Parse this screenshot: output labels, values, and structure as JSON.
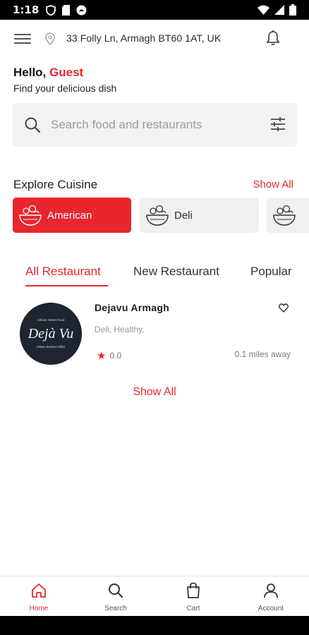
{
  "status_bar": {
    "time": "1:18"
  },
  "header": {
    "address": "33 Folly Ln, Armagh BT60 1AT, UK"
  },
  "greeting": {
    "hello": "Hello,",
    "name": "Guest",
    "subtitle": "Find your delicious dish"
  },
  "search": {
    "placeholder": "Search food and restaurants"
  },
  "explore": {
    "title": "Explore Cuisine",
    "show_all": "Show All",
    "cuisines": [
      {
        "label": "American",
        "selected": true
      },
      {
        "label": "Deli",
        "selected": false
      },
      {
        "label": "",
        "selected": false
      }
    ]
  },
  "tabs": [
    {
      "label": "All Restaurant",
      "active": true
    },
    {
      "label": "New Restaurant",
      "active": false
    },
    {
      "label": "Popular",
      "active": false
    }
  ],
  "restaurants": [
    {
      "name": "Dejavu Armagh",
      "tags": "Deli, Healthy,",
      "rating": "0.0",
      "distance": "0.1 miles away",
      "logo": {
        "top": "Artisan Street Food",
        "main": "Dejà Vu",
        "bottom": "Artisan Barista Coffee"
      }
    }
  ],
  "show_all_bottom": "Show All",
  "bottom_nav": [
    {
      "label": "Home",
      "icon": "home-icon",
      "active": true
    },
    {
      "label": "Search",
      "icon": "search-icon",
      "active": false
    },
    {
      "label": "Cart",
      "icon": "cart-icon",
      "active": false
    },
    {
      "label": "Account",
      "icon": "account-icon",
      "active": false
    }
  ],
  "colors": {
    "accent": "#e8262d",
    "chip_inactive": "#f0f0f0",
    "search_bg": "#f2f2f2"
  }
}
